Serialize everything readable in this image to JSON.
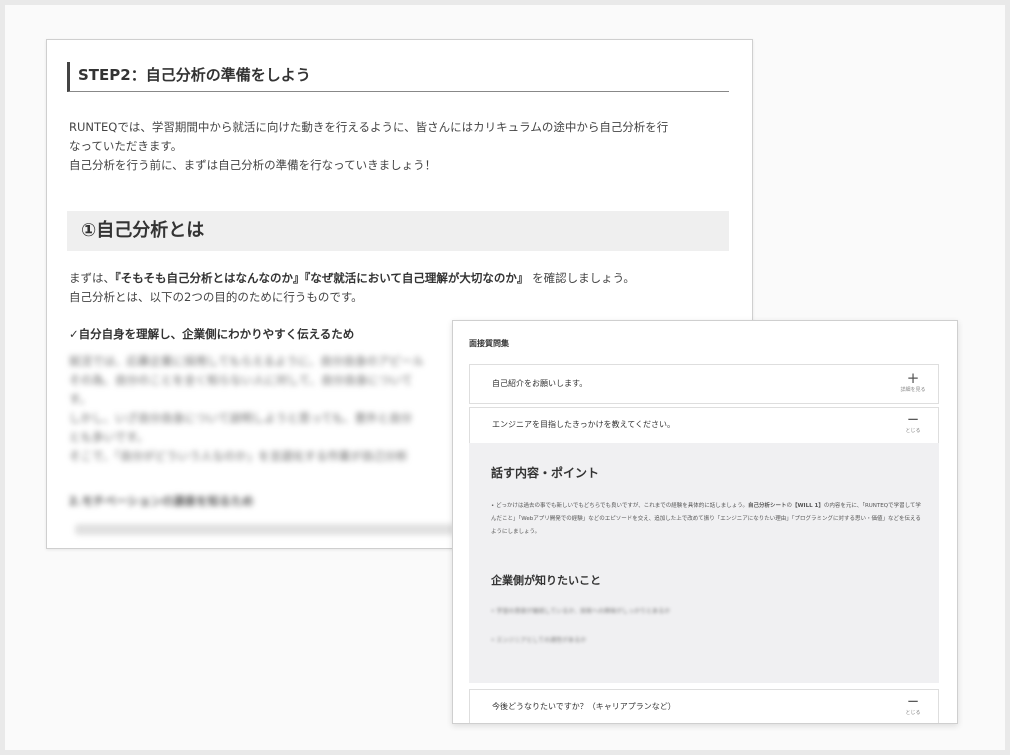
{
  "doc": {
    "step_title": "STEP2：自己分析の準備をしよう",
    "intro_lines": [
      "RUNTEQでは、学習期間中から就活に向けた動きを行えるように、皆さんにはカリキュラムの途中から自己分析を行",
      "なっていただきます。",
      "自己分析を行う前に、まずは自己分析の準備を行なっていきましょう！"
    ],
    "section_heading": "①自己分析とは",
    "body_line1_pre": "まずは、",
    "body_line1_bold": "『そもそも自己分析とはなんなのか』『なぜ就活において自己理解が大切なのか』",
    "body_line1_post": " を確認しましょう。",
    "body_line2": "自己分析とは、以下の2つの目的のために行うものです。",
    "check_heading": "✓自分自身を理解し、企業側にわかりやすく伝えるため",
    "blurred_lines": [
      "就活では、応募企業に採用してもらえるように、自分自身のアピール",
      "その為、自分のことを全く知らない人に対して、自分自身について",
      "す。",
      "しかし、いざ自分自身について説明しようと思っても、意外と自分",
      "とも多いです。",
      "そこで、「自分がどういう人なのか」を言語化する作業が自己分析"
    ],
    "blurred_footer": "2.モチベーションの源泉を知るため"
  },
  "qa": {
    "title": "面接質問集",
    "items": [
      {
        "question": "自己紹介をお願いします。",
        "toggle_symbol": "+",
        "toggle_label": "詳細を見る"
      },
      {
        "question": "エンジニアを目指したきっかけを教えてください。",
        "toggle_symbol": "−",
        "toggle_label": "とじる"
      },
      {
        "question": "今後どうなりたいですか？（キャリアプランなど）",
        "toggle_symbol": "−",
        "toggle_label": "とじる"
      }
    ],
    "panel": {
      "heading1": "話す内容・ポイント",
      "paragraph_pre": "• どっかけは過去の事でも新しいでもどちらでも良いですが、これまでの経験を具体的に話しましょう。",
      "paragraph_bold": "自己分析シート",
      "paragraph_mid": "の",
      "paragraph_bold2": "【WILL 1】",
      "paragraph_post": "の内容を元に、「RUNTEQで学習して学んだこと」「Webアプリ開発での経験」などのエピソードを交え、追加した上で改めて振り「エンジニアになりたい理由」「プログラミングに対する思い・価値」などを伝えるようにしましょう。",
      "heading2": "企業側が知りたいこと",
      "blur_lines": [
        "• 学習の意欲が継続しているか、技術への興味がしっかりとあるか",
        "• エンジニアとしての適性があるか"
      ]
    }
  }
}
